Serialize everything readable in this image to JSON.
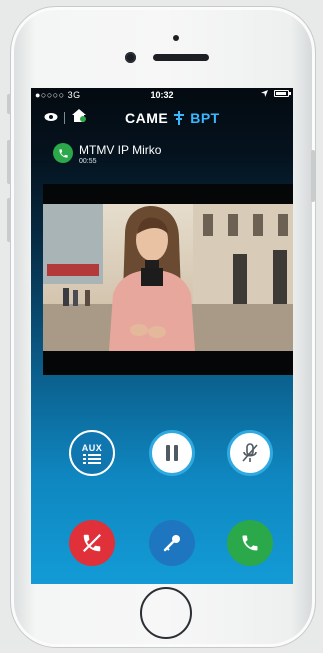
{
  "status_bar": {
    "signal": "●○○○○ 3G",
    "time": "10:32"
  },
  "header": {
    "brand_came": "CAME",
    "brand_bpt": "BPT"
  },
  "call": {
    "name": "MTMV IP Mirko",
    "duration": "00:55"
  },
  "controls": {
    "aux_label": "AUX"
  },
  "icons": {
    "eye": "eye-icon",
    "home": "home-icon",
    "phone": "phone-icon",
    "pause": "pause-icon",
    "mic_off": "mic-off-icon",
    "hangup": "hangup-icon",
    "key": "key-icon",
    "answer": "answer-icon"
  },
  "colors": {
    "accent": "#2fa9e0",
    "hangup": "#e0303a",
    "answer": "#2ba84a",
    "brand_blue": "#3ab8ff"
  }
}
